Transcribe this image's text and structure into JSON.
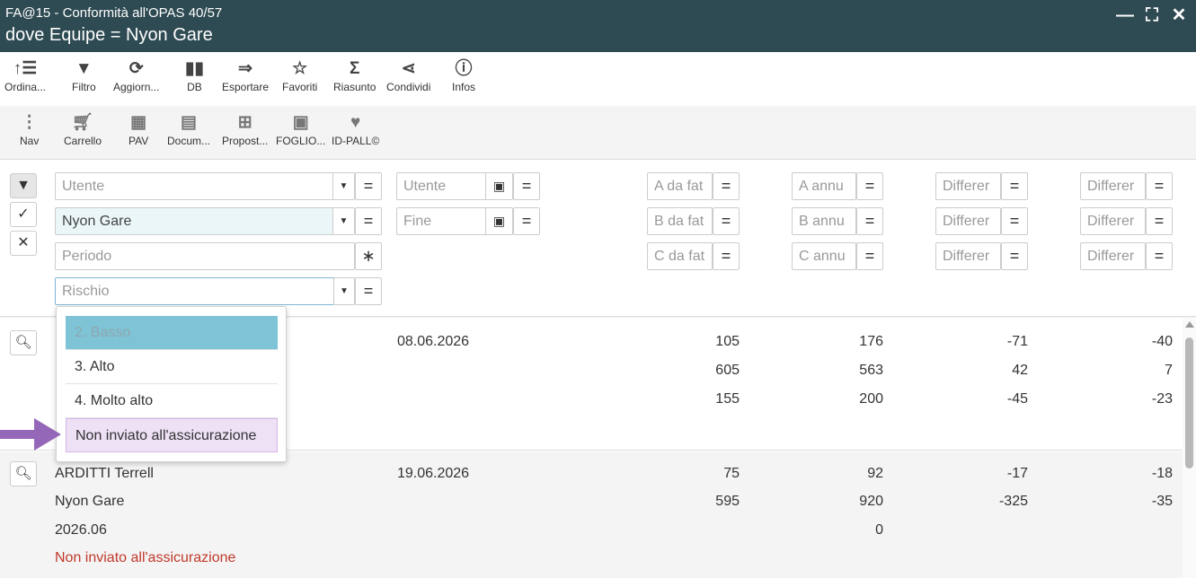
{
  "window": {
    "title": "FA@15 - Conformità all'OPAS 40/57",
    "subtitle": "dove Equipe = Nyon Gare",
    "controls": [
      "—",
      "⛶",
      "✕"
    ]
  },
  "toolbar": {
    "row1": [
      {
        "label": "Ordina...",
        "icon": "sort-icon"
      },
      {
        "label": "Filtro",
        "icon": "filter-icon"
      },
      {
        "label": "Aggiorn...",
        "icon": "refresh-icon"
      },
      {
        "label": "DB",
        "icon": "bar-chart-icon"
      },
      {
        "label": "Esportare",
        "icon": "export-icon"
      },
      {
        "label": "Favoriti",
        "icon": "star-icon"
      },
      {
        "label": "Riasunto",
        "icon": "sigma-icon"
      },
      {
        "label": "Condividi",
        "icon": "share-icon"
      },
      {
        "label": "Infos",
        "icon": "info-icon"
      }
    ],
    "row2": [
      {
        "label": "Nav",
        "icon": "more-vertical-icon"
      },
      {
        "label": "Carrello",
        "icon": "cart-icon"
      },
      {
        "label": "PAV",
        "icon": "grid-icon"
      },
      {
        "label": "Docum...",
        "icon": "book-icon"
      },
      {
        "label": "Propost...",
        "icon": "calendar-plus-icon"
      },
      {
        "label": "FOGLIO...",
        "icon": "document-icon"
      },
      {
        "label": "ID-PALL©",
        "icon": "heart-icon"
      }
    ]
  },
  "filters": {
    "utente": "Utente",
    "equipe": "Nyon Gare",
    "periodo": "Periodo",
    "rischio": "Rischio",
    "utente_date": "Utente",
    "fine": "Fine",
    "a_da_fat": "A da fat",
    "b_da_fat": "B da fat",
    "c_da_fat": "C da fat",
    "a_annu": "A annu",
    "b_annu": "B annu",
    "c_annu": "C annu",
    "differ": "Differer",
    "eq": "=",
    "star": "∗"
  },
  "dropdown": {
    "options": [
      "2. Basso",
      "3. Alto",
      "4. Molto alto",
      "Non inviato all'assicurazione"
    ]
  },
  "rows": [
    {
      "date": "08.06.2026",
      "c1": [
        "105",
        "605",
        "155"
      ],
      "c2": [
        "176",
        "563",
        "200"
      ],
      "c3": [
        "-71",
        "42",
        "-45"
      ],
      "c4": [
        "-40",
        "7",
        "-23"
      ]
    },
    {
      "name": "ARDITTI Terrell",
      "equipe": "Nyon Gare",
      "periodo": "2026.06",
      "status": "Non inviato all'assicurazione",
      "date": "19.06.2026",
      "c1": [
        "75",
        "595"
      ],
      "c2": [
        "92",
        "920",
        "0"
      ],
      "c3": [
        "-17",
        "-325"
      ],
      "c4": [
        "-18",
        "-35"
      ]
    }
  ]
}
